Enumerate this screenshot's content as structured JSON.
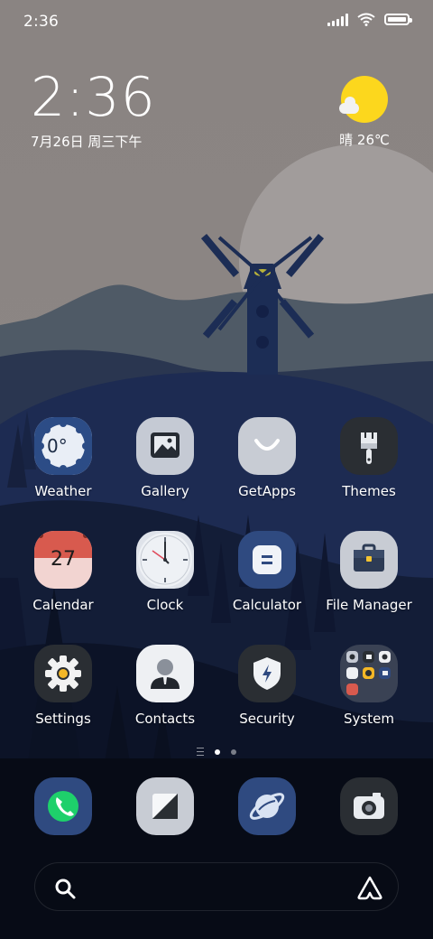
{
  "status_bar": {
    "time": "2:36",
    "icons": [
      "signal-icon",
      "wifi-icon",
      "battery-icon"
    ]
  },
  "clock_widget": {
    "time": "2:36",
    "date": "7月26日 周三下午"
  },
  "weather_widget": {
    "condition_icon": "sun-cloud-icon",
    "text": "晴 26℃"
  },
  "apps": [
    {
      "label": "Weather",
      "icon": "weather-icon"
    },
    {
      "label": "Gallery",
      "icon": "gallery-icon"
    },
    {
      "label": "GetApps",
      "icon": "getapps-icon"
    },
    {
      "label": "Themes",
      "icon": "themes-brush-icon"
    },
    {
      "label": "Calendar",
      "icon": "calendar-icon",
      "badge": "27"
    },
    {
      "label": "Clock",
      "icon": "clock-icon"
    },
    {
      "label": "Calculator",
      "icon": "calculator-icon"
    },
    {
      "label": "File Manager",
      "icon": "file-manager-icon"
    },
    {
      "label": "Settings",
      "icon": "settings-gear-icon"
    },
    {
      "label": "Contacts",
      "icon": "contacts-icon"
    },
    {
      "label": "Security",
      "icon": "security-shield-icon"
    },
    {
      "label": "System",
      "icon": "system-folder-icon"
    }
  ],
  "weather_icon_text": "0°",
  "page_indicator": {
    "pages": 2,
    "active": 1
  },
  "dock": [
    {
      "icon": "phone-icon"
    },
    {
      "icon": "notes-icon"
    },
    {
      "icon": "browser-icon"
    },
    {
      "icon": "camera-icon"
    }
  ],
  "search_bar": {
    "left_icon": "search-icon",
    "right_icon": "assistant-icon"
  },
  "colors": {
    "sky": "#888281",
    "sun_disc": "#a09b9a",
    "weather_sun": "#fcd71d",
    "dark_navy": "#0b1220",
    "windmill": "#1c2d55",
    "calculator_blue": "#2f4a80",
    "calendar_red": "#d85a4e"
  }
}
